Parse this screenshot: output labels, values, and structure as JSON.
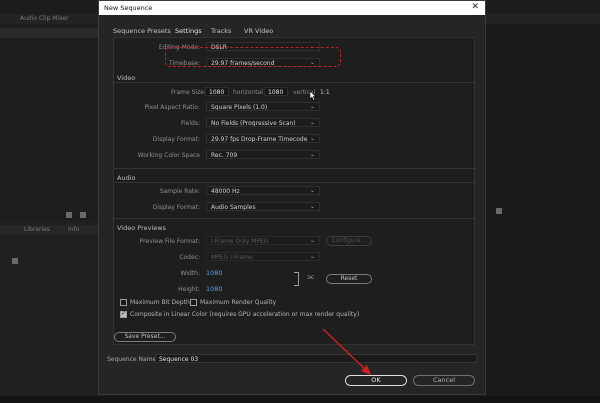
{
  "background": {
    "tabs": [
      "Audio Clip Mixer"
    ],
    "lower_tabs": [
      "Libraries",
      "Info"
    ]
  },
  "dialog": {
    "title": "New Sequence",
    "close_glyph": "✕",
    "tabs": [
      {
        "label": "Sequence Presets",
        "active": false
      },
      {
        "label": "Settings",
        "active": true
      },
      {
        "label": "Tracks",
        "active": false
      },
      {
        "label": "VR Video",
        "active": false
      }
    ],
    "settings": {
      "editing_mode_label": "Editing Mode:",
      "editing_mode_value": "DSLR",
      "timebase_label": "Timebase:",
      "timebase_value": "29.97  frames/second",
      "video_section": "Video",
      "frame_size_label": "Frame Size:",
      "frame_width": "1080",
      "horizontal_label": "horizontal",
      "frame_height": "1080",
      "vertical_label": "vertical",
      "aspect_ratio": "1:1",
      "par_label": "Pixel Aspect Ratio:",
      "par_value": "Square Pixels (1.0)",
      "fields_label": "Fields:",
      "fields_value": "No Fields (Progressive Scan)",
      "display_format_label": "Display Format:",
      "display_format_value": "29.97 fps Drop-Frame Timecode",
      "color_space_label": "Working Color Space",
      "color_space_value": "Rec. 709",
      "audio_section": "Audio",
      "sample_rate_label": "Sample Rate:",
      "sample_rate_value": "48000 Hz",
      "audio_display_label": "Display Format:",
      "audio_display_value": "Audio Samples",
      "previews_section": "Video Previews",
      "preview_format_label": "Preview File Format:",
      "preview_format_value": "I-Frame Only MPEG",
      "configure_label": "Configure...",
      "codec_label": "Codec:",
      "codec_value": "MPEG I-Frame",
      "width_label": "Width:",
      "width_value": "1080",
      "height_label": "Height:",
      "height_value": "1080",
      "reset_label": "Reset",
      "max_bit_depth": "Maximum Bit Depth",
      "max_render_quality": "Maximum Render Quality",
      "composite_linear": "Composite in Linear Color (requires GPU acceleration or max render quality)",
      "save_preset": "Save Preset..."
    },
    "sequence_name_label": "Sequence Name:",
    "sequence_name_value": "Sequence 03",
    "ok_label": "OK",
    "cancel_label": "Cancel"
  },
  "colors": {
    "highlight": "#c0242b",
    "link_blue": "#4aa3ff",
    "arrow": "#d21f26"
  }
}
